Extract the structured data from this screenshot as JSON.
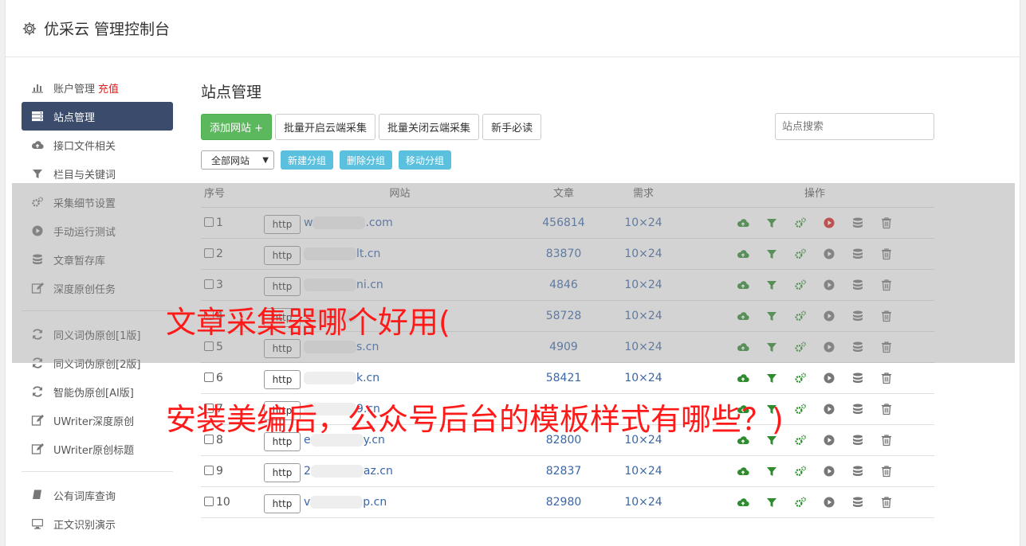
{
  "header": {
    "title": "优采云 管理控制台"
  },
  "sidebar": {
    "group1": [
      {
        "label": "账户管理",
        "badge": "充值",
        "icon": "bar-chart-icon"
      },
      {
        "label": "站点管理",
        "icon": "server-icon",
        "active": true
      },
      {
        "label": "接口文件相关",
        "icon": "cloud-upload-icon"
      },
      {
        "label": "栏目与关键词",
        "icon": "filter-icon"
      },
      {
        "label": "采集细节设置",
        "icon": "gears-icon"
      },
      {
        "label": "手动运行测试",
        "icon": "play-icon"
      },
      {
        "label": "文章暂存库",
        "icon": "database-icon"
      },
      {
        "label": "深度原创任务",
        "icon": "edit-icon"
      }
    ],
    "group2": [
      {
        "label": "同义词伪原创[1版]",
        "icon": "refresh-icon"
      },
      {
        "label": "同义词伪原创[2版]",
        "icon": "refresh-icon"
      },
      {
        "label": "智能伪原创[AI版]",
        "icon": "refresh-icon"
      },
      {
        "label": "UWriter深度原创",
        "icon": "edit-icon"
      },
      {
        "label": "UWriter原创标题",
        "icon": "edit-icon"
      }
    ],
    "group3": [
      {
        "label": "公有词库查询",
        "icon": "book-icon"
      },
      {
        "label": "正文识别演示",
        "icon": "monitor-icon"
      }
    ]
  },
  "main": {
    "title": "站点管理",
    "buttons": {
      "add_site": "添加网站 +",
      "batch_open": "批量开启云端采集",
      "batch_close": "批量关闭云端采集",
      "newbie": "新手必读"
    },
    "search_placeholder": "站点搜索",
    "group_select": "全部网站",
    "group_buttons": {
      "new_group": "新建分组",
      "delete_group": "删除分组",
      "move_group": "移动分组"
    },
    "table": {
      "headers": {
        "num": "序号",
        "site": "网站",
        "articles": "文章",
        "demand": "需求",
        "ops": "操作"
      },
      "protocol_label": "http",
      "rows": [
        {
          "num": "1",
          "domain_prefix": "w",
          "domain_suffix": ".com",
          "articles": "456814",
          "demand": "10×24",
          "run_active": true
        },
        {
          "num": "2",
          "domain_prefix": "",
          "domain_suffix": "lt.cn",
          "articles": "83870",
          "demand": "10×24",
          "run_active": false
        },
        {
          "num": "3",
          "domain_prefix": "",
          "domain_suffix": "ni.cn",
          "articles": "4846",
          "demand": "10×24",
          "run_active": false
        },
        {
          "num": "4",
          "domain_prefix": "",
          "domain_suffix": "",
          "articles": "58728",
          "demand": "10×24",
          "run_active": false
        },
        {
          "num": "5",
          "domain_prefix": "",
          "domain_suffix": "s.cn",
          "articles": "4909",
          "demand": "10×24",
          "run_active": false
        },
        {
          "num": "6",
          "domain_prefix": "",
          "domain_suffix": "k.cn",
          "articles": "58421",
          "demand": "10×24",
          "run_active": false
        },
        {
          "num": "7",
          "domain_prefix": "",
          "domain_suffix": "9.cn",
          "articles": "",
          "demand": "",
          "run_active": false
        },
        {
          "num": "8",
          "domain_prefix": "e",
          "domain_suffix": "y.cn",
          "articles": "82800",
          "demand": "10×24",
          "run_active": false
        },
        {
          "num": "9",
          "domain_prefix": "2",
          "domain_suffix": "az.cn",
          "articles": "82837",
          "demand": "10×24",
          "run_active": false
        },
        {
          "num": "10",
          "domain_prefix": "v",
          "domain_suffix": "p.cn",
          "articles": "82980",
          "demand": "10×24",
          "run_active": false
        }
      ]
    }
  },
  "overlay": {
    "line1": "文章采集器哪个好用(",
    "line2": "安装美编后，公众号后台的模板样式有哪些？)"
  },
  "colors": {
    "sidebar_active": "#3b4b6b",
    "primary_green": "#5cb85c",
    "info_blue": "#5bc0de",
    "link_blue": "#3a66a7",
    "overlay_text": "#ff1a1a"
  }
}
